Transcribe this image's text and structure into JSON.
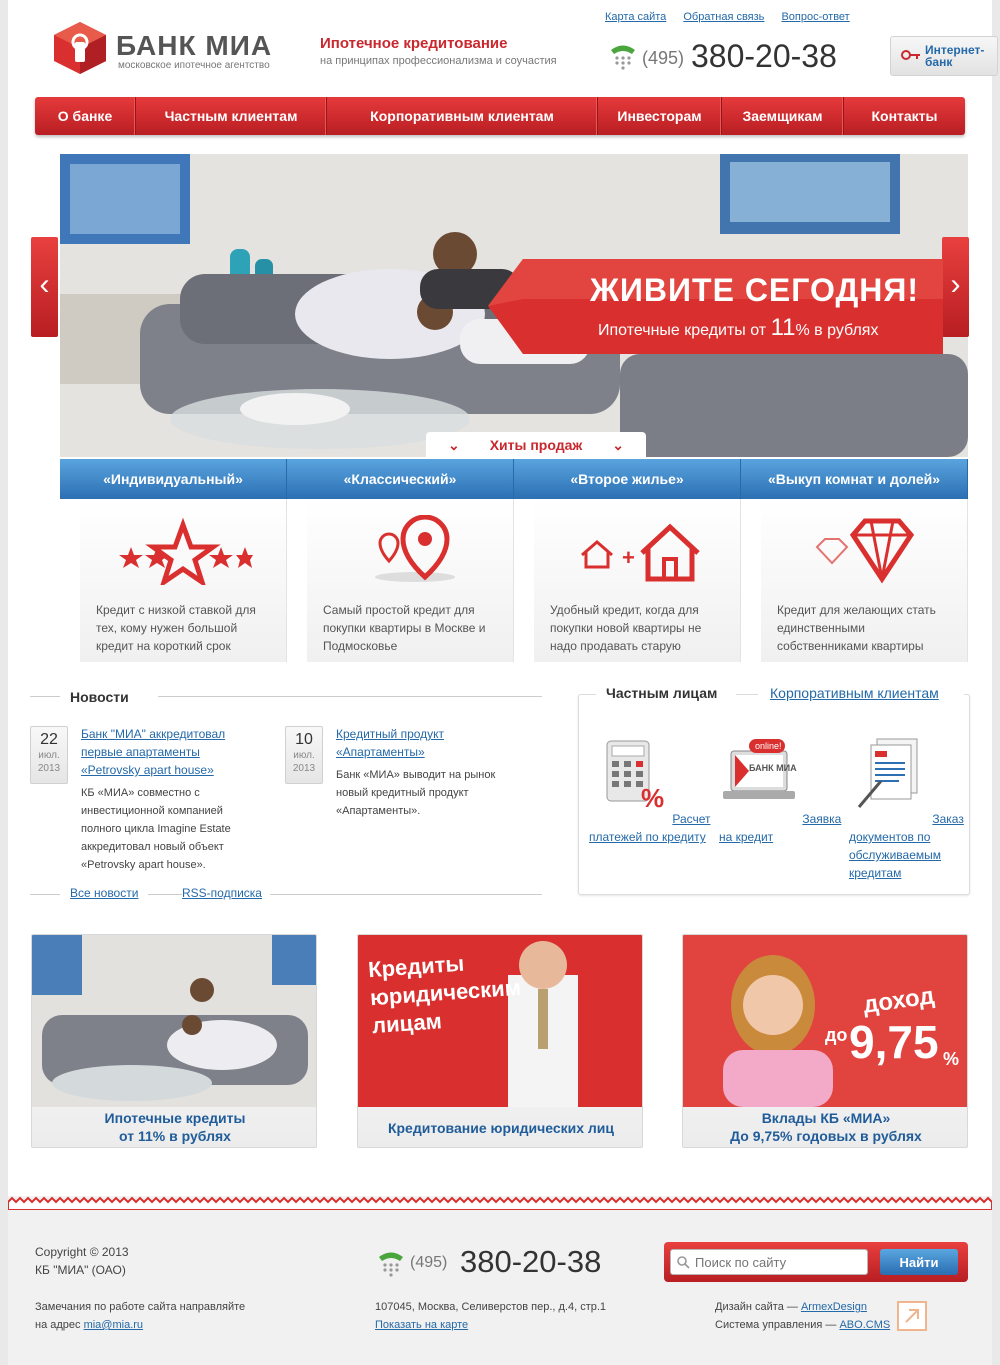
{
  "brand": {
    "name": "БАНК МИА",
    "subtitle": "московское ипотечное агентство",
    "tagline_title": "Ипотечное кредитование",
    "tagline_sub": "на принципах профессионализма и соучастия"
  },
  "toplinks": [
    "Карта сайта",
    "Обратная связь",
    "Вопрос-ответ"
  ],
  "phone": {
    "code": "(495)",
    "number": "380‑20‑38"
  },
  "internet_bank": "Интернет-\nбанк",
  "nav": [
    "О банке",
    "Частным клиентам",
    "Корпоративным клиентам",
    "Инвесторам",
    "Заемщикам",
    "Контакты"
  ],
  "hero": {
    "title": "ЖИВИТЕ СЕГОДНЯ!",
    "sub_pre": "Ипотечные кредиты от ",
    "sub_rate": "11",
    "sub_post": "% в рублях",
    "hits": "Хиты продаж",
    "prev": "‹",
    "next": "›"
  },
  "products": [
    {
      "title": "«Индивидуальный»",
      "text": "Кредит с низкой ставкой для тех, кому нужен большой кредит на короткий срок",
      "icon": "stars-icon"
    },
    {
      "title": "«Классический»",
      "text": "Самый простой кредит для покупки квартиры в Москве и Подмосковье",
      "icon": "map-pin-icon"
    },
    {
      "title": "«Второе жилье»",
      "text": "Удобный кредит, когда для покупки новой квартиры не надо продавать старую",
      "icon": "house-plus-house-icon"
    },
    {
      "title": "«Выкуп комнат и долей»",
      "text": "Кредит для желающих стать единственными собственниками квартиры",
      "icon": "diamond-icon"
    }
  ],
  "news": {
    "heading": "Новости",
    "items": [
      {
        "day": "22",
        "month": "июл.",
        "year": "2013",
        "title": "Банк \"МИА\" аккредитовал первые апартаменты «Petrovsky apart house»",
        "text": "КБ «МИА» совместно с инвестиционной компанией полного цикла Imagine Estate аккредитовал новый объект «Petrovsky apart house»."
      },
      {
        "day": "10",
        "month": "июл.",
        "year": "2013",
        "title": "Кредитный продукт «Апартаменты»",
        "text": "Банк «МИА» выводит на рынок новый кредитный продукт «Апартаменты»."
      }
    ],
    "all_news": "Все новости",
    "rss": "RSS-подписка"
  },
  "private": {
    "tab_active": "Частным лицам",
    "tab_other": "Корпоративным клиентам",
    "services": [
      {
        "label": "Расчет платежей по кредиту",
        "icon": "calculator-icon"
      },
      {
        "label": "Заявка на кредит",
        "icon": "laptop-online-icon",
        "badge": "online!",
        "screen": "БАНК МИА"
      },
      {
        "label": "Заказ документов по обслуживаемым кредитам",
        "icon": "documents-icon"
      }
    ]
  },
  "banners": [
    {
      "caption": "Ипотечные кредиты\nот 11% в рублях"
    },
    {
      "caption": "Кредитование юридических лиц",
      "overlay": "Кредиты юридическим лицам"
    },
    {
      "caption": "Вклады КБ «МИА»\nДо 9,75% годовых в рублях",
      "overlay_top": "доход",
      "overlay_pre": "до",
      "overlay_num": "9,75",
      "overlay_pct": "%"
    }
  ],
  "footer": {
    "copyright": "Copyright © 2013",
    "company": "КБ \"МИА\" (ОАО)",
    "remarks": "Замечания по работе сайта направляйте",
    "remarks_pre": "на адрес ",
    "email": "mia@mia.ru",
    "address": "107045, Москва, Селиверстов пер., д.4, стр.1",
    "map_link": "Показать на карте",
    "design_pre": "Дизайн сайта — ",
    "design_link": "ArmexDesign",
    "cms_pre": "Система управления — ",
    "cms_link": "ABO.CMS",
    "search_placeholder": "Поиск по сайту",
    "search_button": "Найти"
  },
  "colors": {
    "brand_red": "#c8282e",
    "nav_red": "#d9302f",
    "blue": "#2c6fb3",
    "link": "#2469a8"
  }
}
